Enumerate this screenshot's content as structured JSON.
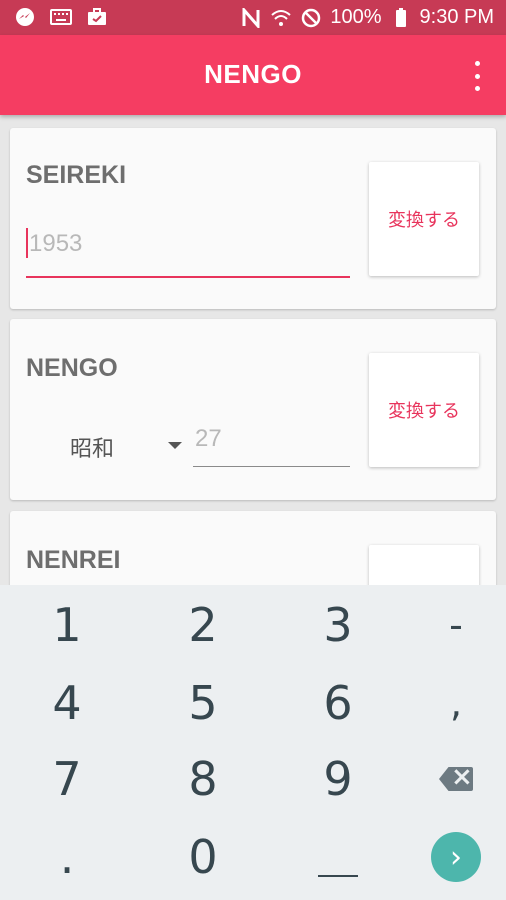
{
  "status_bar": {
    "battery_text": "100%",
    "time": "9:30 PM",
    "left_icons": [
      "messenger-icon",
      "keyboard-icon",
      "briefcase-icon"
    ],
    "right_icons": [
      "nfc-icon",
      "wifi-icon",
      "blocked-icon",
      "battery-icon"
    ]
  },
  "app_bar": {
    "title": "NENGO",
    "overflow_icon": "more-vert-icon"
  },
  "cards": {
    "seireki": {
      "label": "SEIREKI",
      "input_placeholder": "1953",
      "convert_label": "変換する"
    },
    "nengo": {
      "label": "NENGO",
      "era_selected": "昭和",
      "year_placeholder": "27",
      "convert_label": "変換する"
    },
    "nenrei": {
      "label": "NENREI"
    }
  },
  "keyboard": {
    "rows": [
      [
        "1",
        "2",
        "3",
        "-"
      ],
      [
        "4",
        "5",
        "6",
        ","
      ],
      [
        "7",
        "8",
        "9",
        "backspace"
      ],
      [
        ".",
        "0",
        "space",
        "enter"
      ]
    ]
  },
  "colors": {
    "primary": "#f53d62",
    "status_bar": "#c73a55",
    "accent": "#e8345c",
    "keyboard_bg": "#eceff1",
    "enter_key": "#4db6ac"
  }
}
